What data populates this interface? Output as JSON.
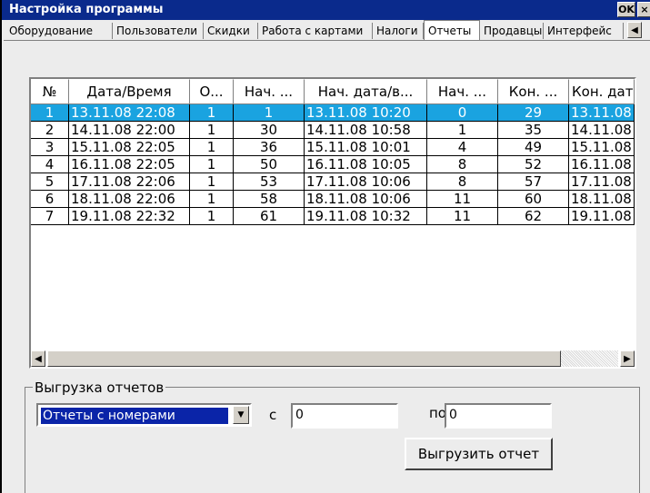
{
  "window": {
    "title": "Настройка программы",
    "ok_label": "OK",
    "close_label": "×"
  },
  "tabs": [
    {
      "label": "Оборудование"
    },
    {
      "label": "Пользователи"
    },
    {
      "label": "Скидки"
    },
    {
      "label": "Работа с картами"
    },
    {
      "label": "Налоги"
    },
    {
      "label": "Отчеты",
      "active": true
    },
    {
      "label": "Продавцы"
    },
    {
      "label": "Интерфейс"
    }
  ],
  "tab_scroll_icon": "arrow-left-icon",
  "grid": {
    "headers": [
      "№",
      "Дата/Время",
      "О...",
      "Нач. ...",
      "Нач. дата/в...",
      "Нач. ...",
      "Кон. ...",
      "Кон. дата"
    ],
    "rows": [
      [
        "1",
        "13.11.08 22:08",
        "1",
        "1",
        "13.11.08 10:20",
        "0",
        "29",
        "13.11.08"
      ],
      [
        "2",
        "14.11.08 22:00",
        "1",
        "30",
        "14.11.08 10:58",
        "1",
        "35",
        "14.11.08"
      ],
      [
        "3",
        "15.11.08 22:05",
        "1",
        "36",
        "15.11.08 10:01",
        "4",
        "49",
        "15.11.08"
      ],
      [
        "4",
        "16.11.08 22:05",
        "1",
        "50",
        "16.11.08 10:05",
        "8",
        "52",
        "16.11.08"
      ],
      [
        "5",
        "17.11.08 22:06",
        "1",
        "53",
        "17.11.08 10:06",
        "8",
        "57",
        "17.11.08"
      ],
      [
        "6",
        "18.11.08 22:06",
        "1",
        "58",
        "18.11.08 10:06",
        "11",
        "60",
        "18.11.08"
      ],
      [
        "7",
        "19.11.08 22:32",
        "1",
        "61",
        "19.11.08 10:32",
        "11",
        "62",
        "19.11.08"
      ]
    ],
    "selected_row": 0,
    "selected_color": "#1aa3e0"
  },
  "export": {
    "group_label": "Выгрузка отчетов",
    "type_value": "Отчеты с номерами",
    "from_label": "с",
    "from_value": "0",
    "to_label": "по",
    "to_value": "0",
    "button_label": "Выгрузить отчет"
  },
  "colors": {
    "titlebar": "#0a2a8c",
    "selection": "#0a24a8"
  }
}
